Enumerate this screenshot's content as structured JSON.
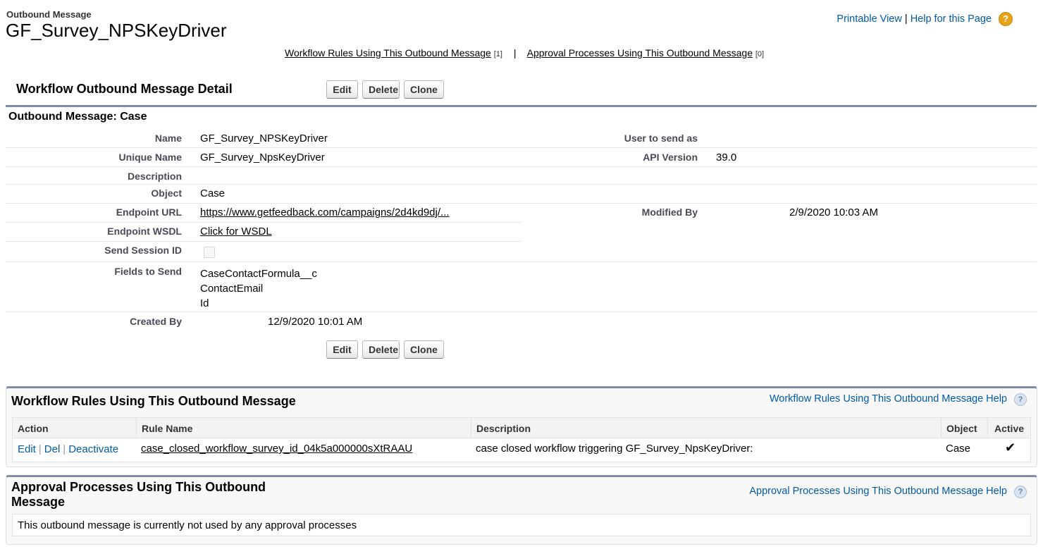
{
  "header": {
    "page_type": "Outbound Message",
    "title": "GF_Survey_NPSKeyDriver",
    "printable_view": "Printable View",
    "separator": "|",
    "help_link": "Help for this Page",
    "help_icon": "?"
  },
  "related_links": {
    "workflow_rules": "Workflow Rules Using This Outbound Message",
    "workflow_rules_count": "[1]",
    "separator": "|",
    "approval_processes": "Approval Processes Using This Outbound Message",
    "approval_processes_count": "[0]"
  },
  "detail": {
    "heading": "Workflow Outbound Message Detail",
    "buttons": {
      "edit": "Edit",
      "delete": "Delete",
      "clone": "Clone"
    },
    "section_title": "Outbound Message: Case",
    "fields": {
      "name_label": "Name",
      "name_value": "GF_Survey_NPSKeyDriver",
      "unique_name_label": "Unique Name",
      "unique_name_value": "GF_Survey_NpsKeyDriver",
      "description_label": "Description",
      "description_value": "",
      "object_label": "Object",
      "object_value": "Case",
      "endpoint_url_label": "Endpoint URL",
      "endpoint_url_value": "https://www.getfeedback.com/campaigns/2d4kd9dj/...",
      "endpoint_wsdl_label": "Endpoint WSDL",
      "endpoint_wsdl_value": "Click for WSDL",
      "send_session_label": "Send Session ID",
      "send_session_checked": false,
      "fields_to_send_label": "Fields to Send",
      "fields_to_send": [
        "CaseContactFormula__c",
        "ContactEmail",
        "Id"
      ],
      "created_by_label": "Created By",
      "created_by_value": "12/9/2020 10:01 AM",
      "user_to_send_label": "User to send as",
      "user_to_send_value": "",
      "api_version_label": "API Version",
      "api_version_value": "39.0",
      "modified_by_label": "Modified By",
      "modified_by_value": "2/9/2020 10:03 AM"
    }
  },
  "workflow_list": {
    "title": "Workflow Rules Using This Outbound Message",
    "help": "Workflow Rules Using This Outbound Message Help",
    "help_icon": "?",
    "columns": [
      "Action",
      "Rule Name",
      "Description",
      "Object",
      "Active"
    ],
    "rows": [
      {
        "actions": [
          "Edit",
          "Del",
          "Deactivate"
        ],
        "action_separator": "|",
        "rule_name": "case_closed_workflow_survey_id_04k5a000000sXtRAAU",
        "description": "case closed workflow triggering GF_Survey_NpsKeyDriver:",
        "object": "Case",
        "active": "✔"
      }
    ]
  },
  "approval_list": {
    "title_line1": "Approval Processes Using This Outbound",
    "title_line2": "Message",
    "help": "Approval Processes Using This Outbound Message Help",
    "help_icon": "?",
    "empty_message": "This outbound message is currently not used by any approval processes"
  }
}
